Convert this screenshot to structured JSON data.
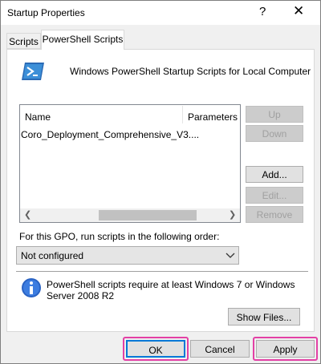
{
  "window": {
    "title": "Startup Properties",
    "help_glyph": "?",
    "close_glyph": "✕"
  },
  "tabs": [
    {
      "label": "Scripts",
      "active": false
    },
    {
      "label": "PowerShell Scripts",
      "active": true
    }
  ],
  "panel": {
    "heading": "Windows PowerShell Startup Scripts for Local Computer",
    "icon": "powershell-icon"
  },
  "list": {
    "columns": [
      "Name",
      "Parameters"
    ],
    "rows": [
      {
        "name": "Coro_Deployment_Comprehensive_V3....",
        "parameters": ""
      }
    ]
  },
  "side_buttons": {
    "up": "Up",
    "down": "Down",
    "add": "Add...",
    "edit": "Edit...",
    "remove": "Remove"
  },
  "order": {
    "label": "For this GPO, run scripts in the following order:",
    "selected": "Not configured"
  },
  "info": {
    "text": "PowerShell scripts require at least Windows 7 or Windows Server 2008 R2",
    "icon": "info-icon"
  },
  "show_files": "Show Files...",
  "footer": {
    "ok": "OK",
    "cancel": "Cancel",
    "apply": "Apply"
  },
  "colors": {
    "highlight": "#e340a5",
    "focus": "#0078d7"
  }
}
